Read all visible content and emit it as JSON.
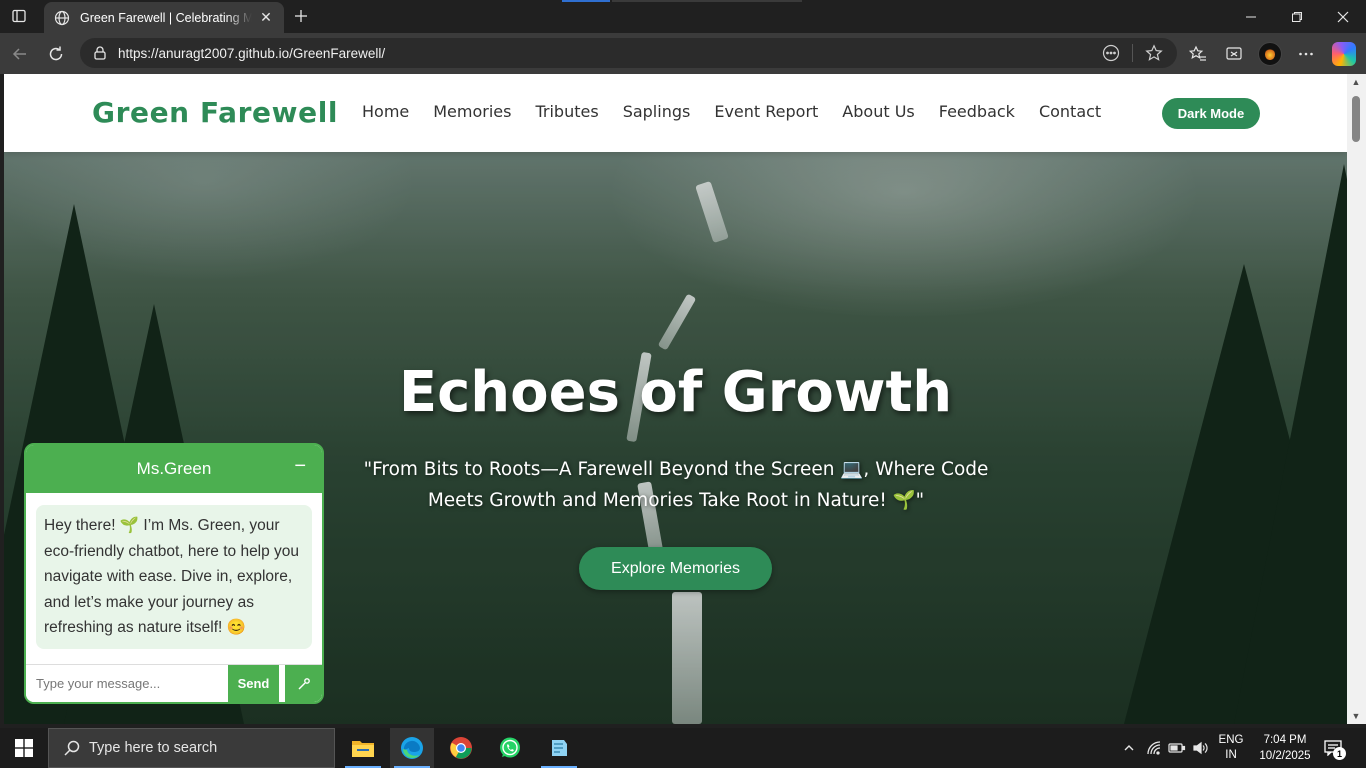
{
  "browser": {
    "tab_title": "Green Farewell | Celebrating Memories",
    "url": "https://anuragt2007.github.io/GreenFarewell/"
  },
  "site": {
    "brand": "Green Farewell",
    "nav": [
      "Home",
      "Memories",
      "Tributes",
      "Saplings",
      "Event Report",
      "About Us",
      "Feedback",
      "Contact"
    ],
    "dark_mode_label": "Dark Mode",
    "hero": {
      "title": "Echoes of Growth",
      "subtitle": "\"From Bits to Roots—A Farewell Beyond the Screen 💻, Where Code Meets Growth and Memories Take Root in Nature! 🌱\"",
      "button": "Explore Memories"
    },
    "accent_color": "#2e8b57"
  },
  "chatbot": {
    "name": "Ms.Green",
    "minimize": "−",
    "message": "Hey there! 🌱 I’m Ms. Green, your eco-friendly chatbot, here to help you navigate with ease. Dive in, explore, and let’s make your journey as refreshing as nature itself! 😊",
    "input_placeholder": "Type your message...",
    "send_label": "Send",
    "mic_icon": "microphone-icon",
    "color": "#4caf50"
  },
  "taskbar": {
    "search_placeholder": "Type here to search",
    "lang_line1": "ENG",
    "lang_line2": "IN",
    "time": "7:04 PM",
    "date": "10/2/2025",
    "notification_count": "1"
  }
}
